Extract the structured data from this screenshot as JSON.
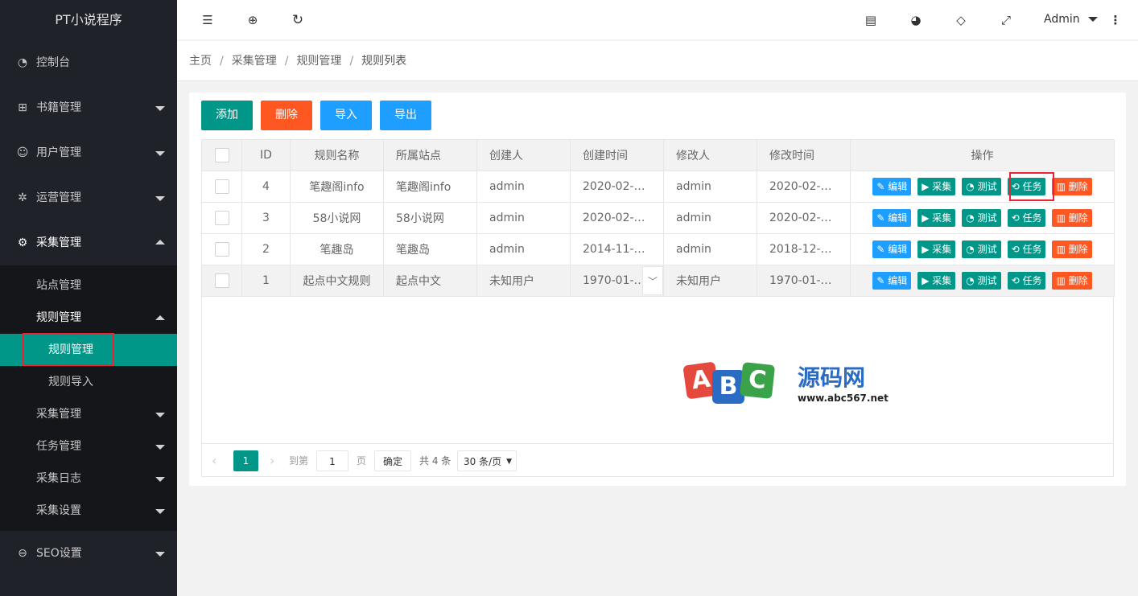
{
  "app": {
    "title": "PT小说程序"
  },
  "sidebar": {
    "items": [
      {
        "label": "控制台",
        "icon": "dashboard-icon"
      },
      {
        "label": "书籍管理",
        "icon": "book-icon"
      },
      {
        "label": "用户管理",
        "icon": "user-icon"
      },
      {
        "label": "运营管理",
        "icon": "operation-icon"
      },
      {
        "label": "采集管理",
        "icon": "gear-icon"
      }
    ],
    "collect_sub": [
      {
        "label": "站点管理"
      },
      {
        "label": "规则管理"
      },
      {
        "label": "采集管理"
      },
      {
        "label": "任务管理"
      },
      {
        "label": "采集日志"
      },
      {
        "label": "采集设置"
      }
    ],
    "rule_sub": [
      {
        "label": "规则管理"
      },
      {
        "label": "规则导入"
      }
    ],
    "seo": {
      "label": "SEO设置",
      "icon": "seo-icon"
    }
  },
  "header": {
    "user": "Admin"
  },
  "breadcrumb": [
    "主页",
    "采集管理",
    "规则管理",
    "规则列表"
  ],
  "toolbar": {
    "add": "添加",
    "delete": "删除",
    "import": "导入",
    "export": "导出"
  },
  "table": {
    "headers": [
      "ID",
      "规则名称",
      "所属站点",
      "创建人",
      "创建时间",
      "修改人",
      "修改时间",
      "操作"
    ],
    "rows": [
      {
        "id": "4",
        "name": "笔趣阁info",
        "site": "笔趣阁info",
        "creator": "admin",
        "created": "2020-02-1...",
        "modifier": "admin",
        "modified": "2020-02-1..."
      },
      {
        "id": "3",
        "name": "58小说网",
        "site": "58小说网",
        "creator": "admin",
        "created": "2020-02-1...",
        "modifier": "admin",
        "modified": "2020-02-1..."
      },
      {
        "id": "2",
        "name": "笔趣岛",
        "site": "笔趣岛",
        "creator": "admin",
        "created": "2014-11-0...",
        "modifier": "admin",
        "modified": "2018-12-0..."
      },
      {
        "id": "1",
        "name": "起点中文规则",
        "site": "起点中文",
        "creator": "未知用户",
        "created": "1970-01-0...",
        "modifier": "未知用户",
        "modified": "1970-01-0..."
      }
    ],
    "actions": {
      "edit": "编辑",
      "collect": "采集",
      "test": "测试",
      "task": "任务",
      "delete": "删除"
    }
  },
  "watermark": {
    "abc": "ABC",
    "text": "源码网",
    "url": "www.abc567.net"
  },
  "pager": {
    "current": "1",
    "goto": "到第",
    "page_value": "1",
    "page_unit": "页",
    "confirm": "确定",
    "total": "共 4 条",
    "per_page": "30 条/页"
  },
  "colors": {
    "sidebar": "#20222a",
    "accent": "#009688",
    "blue": "#1E9FFF",
    "orange": "#FF5722",
    "highlight": "#e23"
  }
}
